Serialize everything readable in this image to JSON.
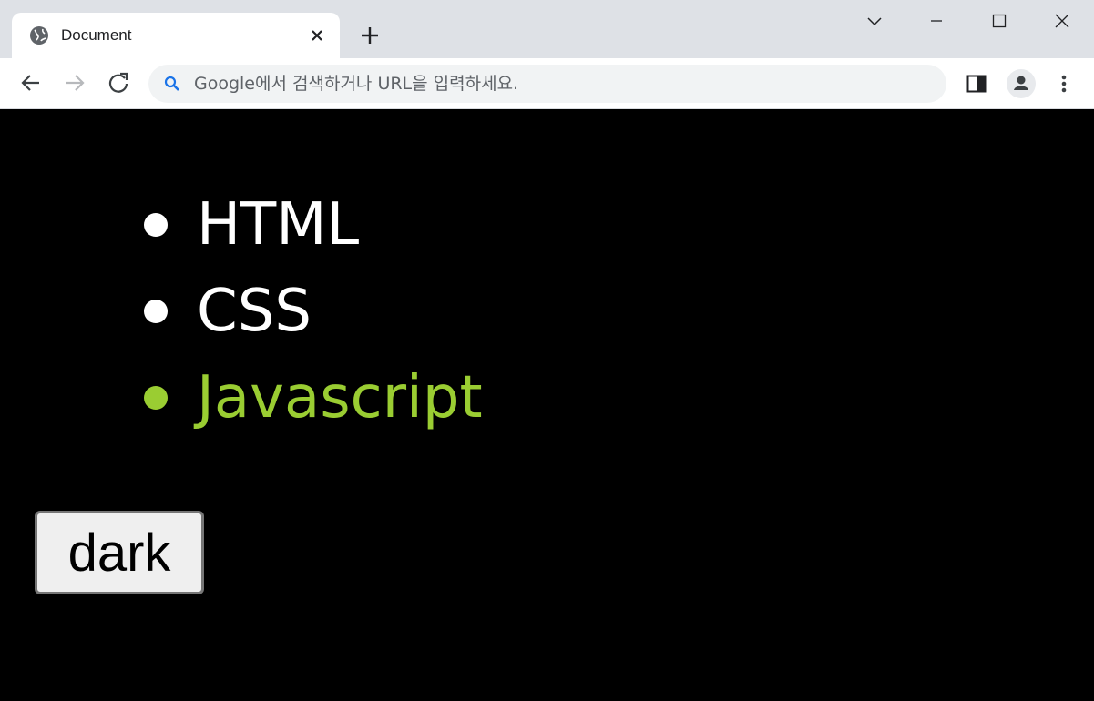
{
  "browser": {
    "tab": {
      "title": "Document",
      "favicon": "globe-icon"
    },
    "new_tab_icon": "plus-icon",
    "window_controls": [
      "chevron-down-icon",
      "minimize-icon",
      "maximize-icon",
      "close-icon"
    ],
    "toolbar": {
      "back_icon": "back-arrow-icon",
      "forward_icon": "forward-arrow-icon",
      "reload_icon": "reload-icon",
      "omnibox": {
        "value": "",
        "placeholder": "Google에서 검색하거나 URL을 입력하세요."
      },
      "side_panel_icon": "side-panel-icon",
      "profile_icon": "profile-icon",
      "menu_icon": "kebab-menu-icon"
    }
  },
  "page": {
    "list": [
      {
        "label": "HTML"
      },
      {
        "label": "CSS"
      },
      {
        "label": "Javascript"
      }
    ],
    "dark_button_label": "dark",
    "colors": {
      "background": "#000000",
      "text": "#ffffff",
      "highlight": "#9acd32"
    }
  }
}
